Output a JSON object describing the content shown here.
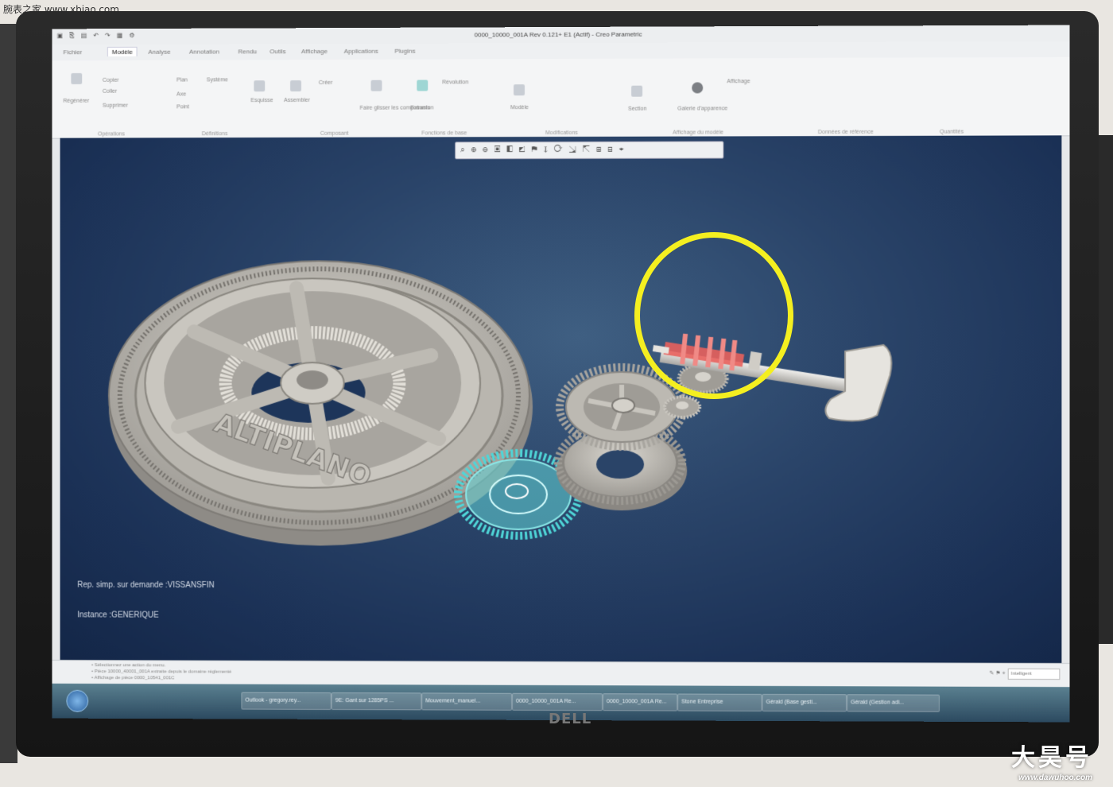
{
  "watermarks": {
    "top_left": "腕表之家 www.xbiao.com",
    "bottom_right_brand": "大昊号",
    "bottom_right_url": "www.dawuhoo.com"
  },
  "monitor": {
    "brand_logo": "DELL"
  },
  "app": {
    "window_title": "0000_10000_001A Rev 0.121+ E1 (Actif) - Creo Parametric",
    "tabs": [
      "Fichier",
      "Modèle",
      "Analyse",
      "Annotation",
      "Rendu",
      "Outils",
      "Affichage",
      "Applications",
      "Plugins"
    ],
    "active_tab": "Modèle",
    "ribbon_groups": [
      "Opérations",
      "Définitions",
      "Composant",
      "Fonctions de base",
      "Modifications",
      "Affichage du modèle",
      "Données de référence",
      "Quantités"
    ],
    "ribbon_buttons": {
      "regenerate": "Régénérer",
      "copy": "Copier",
      "paste": "Coller",
      "delete": "Supprimer",
      "plane": "Plan",
      "axis": "Axe",
      "point": "Point",
      "csys": "Système",
      "sketch": "Esquisse",
      "assemble": "Assembler",
      "create": "Créer",
      "extrude": "Extrusion",
      "revolve": "Révolution",
      "flexible": "Faire glisser les composants",
      "modify": "Modèle",
      "section": "Section",
      "appearance": "Galerie d'apparence",
      "display": "Affichage"
    }
  },
  "viewport": {
    "background": "#1f3a5e",
    "brand_text": "ALTIPLANO",
    "rep_text": "Rep. simp. sur demande :VISSANSFIN",
    "instance_text": "Instance :GENERIQUE",
    "highlight_color": "#f4ef20",
    "selected_gear_color": "#4fd6d8",
    "worm_color": "#e8605c"
  },
  "status": {
    "messages": [
      "• Sélectionnez une action du menu.",
      "• Pièce 10000_40001_001A  extraite depuis le domaine réglementé",
      "• Affichage de pièce 0000_10541_001C"
    ],
    "filter": "Intelligent"
  },
  "taskbar": {
    "items": [
      "Outlook - gregory.rey...",
      "9E: Gant sur 1285PS ...",
      "Mouvement_manuel...",
      "0000_10000_001A Re...",
      "0000_10000_001A Re...",
      "Stone Entreprise",
      "Gérald (Base gesti...",
      "Gérald (Gestion adi..."
    ]
  }
}
